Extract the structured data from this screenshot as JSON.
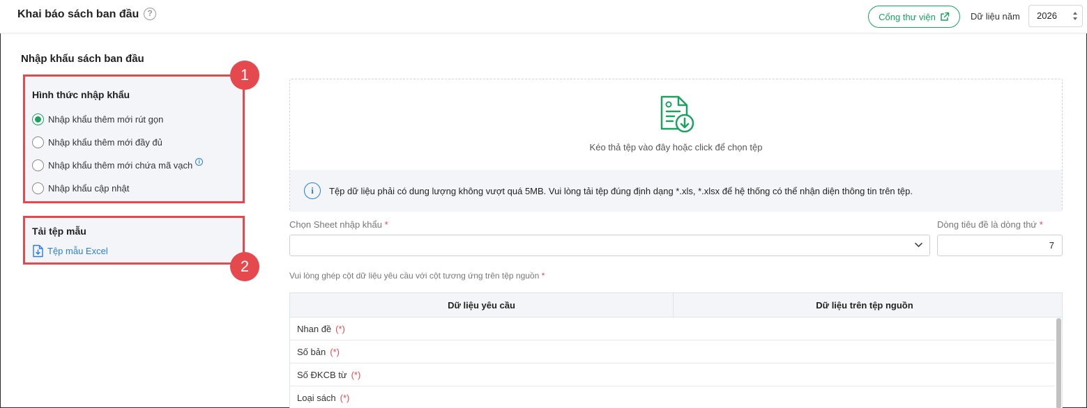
{
  "header": {
    "title": "Khai báo sách ban đầu",
    "help_icon": "question-circle-icon",
    "portal_button": "Cổng thư viện",
    "year_label": "Dữ liệu năm",
    "year_value": "2026"
  },
  "left": {
    "section_title": "Nhập khẩu sách ban đầu",
    "import_type": {
      "title": "Hình thức nhập khẩu",
      "options": [
        {
          "label": "Nhập khẩu thêm mới rút gọn",
          "checked": true
        },
        {
          "label": "Nhập khẩu thêm mới đầy đủ",
          "checked": false
        },
        {
          "label": "Nhập khẩu thêm mới chứa mã vạch",
          "checked": false
        },
        {
          "label": "Nhập khẩu cập nhật",
          "checked": false
        }
      ]
    },
    "template": {
      "title": "Tải tệp mẫu",
      "link": "Tệp mẫu Excel"
    },
    "badges": [
      "1",
      "2"
    ]
  },
  "upload": {
    "drop_text": "Kéo thả tệp vào đây hoặc click để chọn tệp",
    "note": "Tệp dữ liệu phải có dung lượng không vượt quá 5MB. Vui lòng tải tệp đúng định dạng *.xls, *.xlsx để hệ thống có thể nhận diện thông tin trên tệp."
  },
  "fields": {
    "sheet_label": "Chọn Sheet nhập khẩu",
    "sheet_value": "",
    "header_row_label": "Dòng tiêu đề là dòng thứ",
    "header_row_value": "7",
    "required_mark": "*",
    "mapping_label": "Vui lòng ghép cột dữ liệu yêu cầu với cột tương ứng trên tệp nguồn"
  },
  "table": {
    "columns": [
      "Dữ liệu yêu cầu",
      "Dữ liệu trên tệp nguồn"
    ],
    "rows": [
      {
        "name": "Nhan đề",
        "mark": "(*)"
      },
      {
        "name": "Số bản",
        "mark": "(*)"
      },
      {
        "name": "Số ĐKCB từ",
        "mark": "(*)"
      },
      {
        "name": "Loại sách",
        "mark": "(*)"
      }
    ]
  },
  "colors": {
    "accent_green": "#1aa260",
    "annotation_red": "#e5484d",
    "link_blue": "#2a7de1"
  }
}
